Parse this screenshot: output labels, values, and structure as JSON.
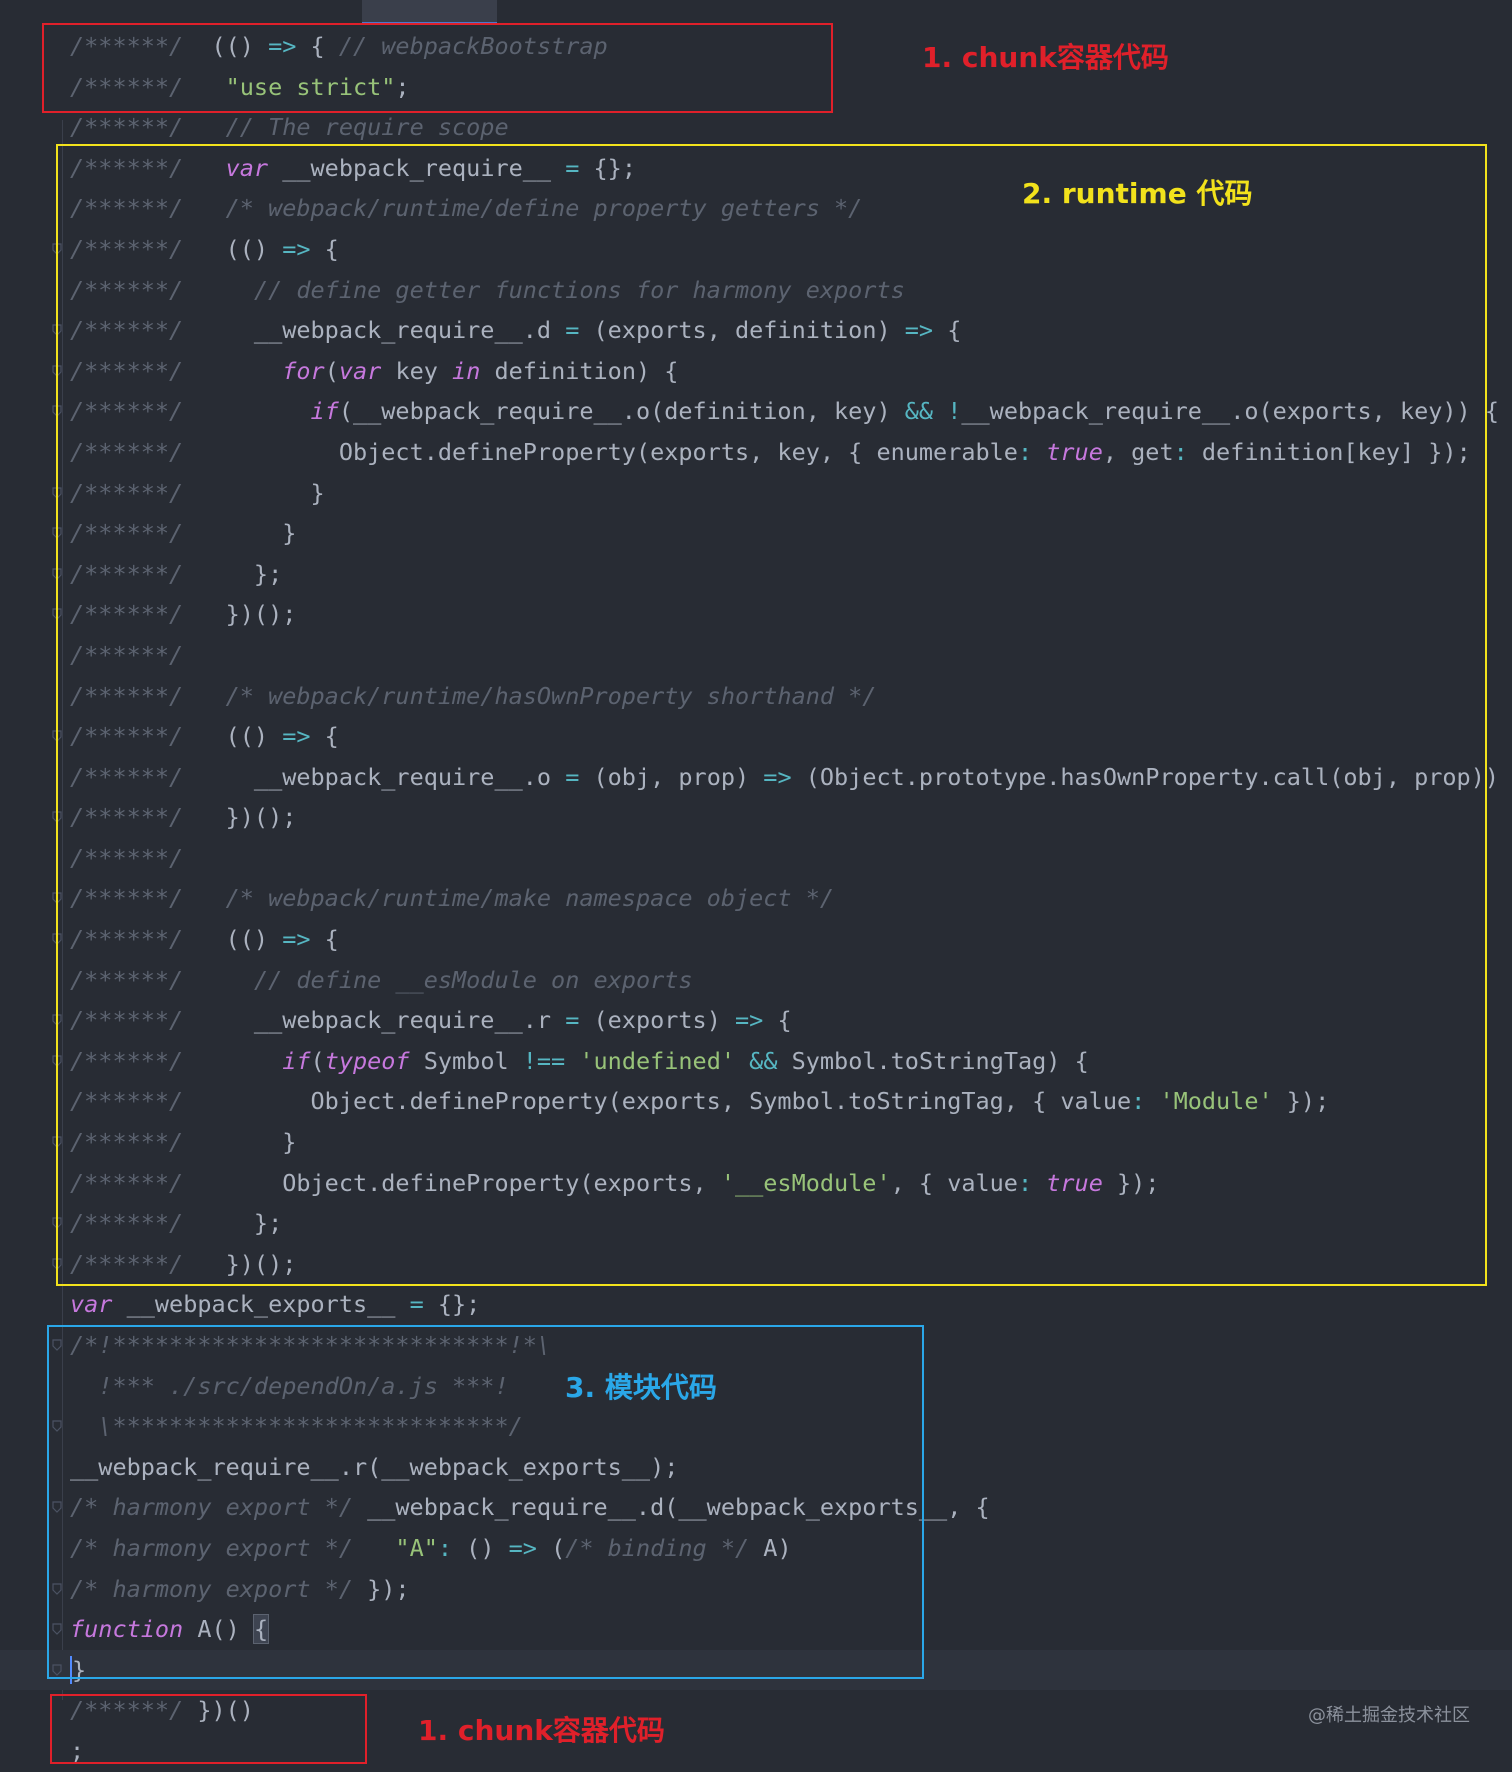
{
  "editor": {
    "line_prefix": "/******/",
    "lines": [
      {
        "fold": false,
        "tokens": [
          [
            "p",
            "/******/ "
          ],
          [
            "t",
            " "
          ],
          [
            "t",
            "(() "
          ],
          [
            "o",
            "=>"
          ],
          [
            "t",
            " { "
          ],
          [
            "c",
            "// webpackBootstrap"
          ]
        ]
      },
      {
        "fold": false,
        "tokens": [
          [
            "p",
            "/******/ "
          ],
          [
            "t",
            "  "
          ],
          [
            "s",
            "\"use strict\""
          ],
          [
            "t",
            ";"
          ]
        ]
      },
      {
        "fold": false,
        "tokens": [
          [
            "p",
            "/******/ "
          ],
          [
            "t",
            "  "
          ],
          [
            "c",
            "// The require scope"
          ]
        ]
      },
      {
        "fold": false,
        "tokens": [
          [
            "p",
            "/******/ "
          ],
          [
            "t",
            "  "
          ],
          [
            "k",
            "var"
          ],
          [
            "t",
            " __webpack_require__ "
          ],
          [
            "o",
            "="
          ],
          [
            "t",
            " {};"
          ]
        ]
      },
      {
        "fold": false,
        "tokens": [
          [
            "p",
            "/******/ "
          ],
          [
            "t",
            "  "
          ],
          [
            "c",
            "/* webpack/runtime/define property getters */"
          ]
        ]
      },
      {
        "fold": true,
        "tokens": [
          [
            "p",
            "/******/ "
          ],
          [
            "t",
            "  (() "
          ],
          [
            "o",
            "=>"
          ],
          [
            "t",
            " {"
          ]
        ]
      },
      {
        "fold": false,
        "tokens": [
          [
            "p",
            "/******/ "
          ],
          [
            "t",
            "    "
          ],
          [
            "c",
            "// define getter functions for harmony exports"
          ]
        ]
      },
      {
        "fold": true,
        "tokens": [
          [
            "p",
            "/******/ "
          ],
          [
            "t",
            "    __webpack_require__.d "
          ],
          [
            "o",
            "="
          ],
          [
            "t",
            " (exports, definition) "
          ],
          [
            "o",
            "=>"
          ],
          [
            "t",
            " {"
          ]
        ]
      },
      {
        "fold": true,
        "tokens": [
          [
            "p",
            "/******/ "
          ],
          [
            "t",
            "      "
          ],
          [
            "k",
            "for"
          ],
          [
            "t",
            "("
          ],
          [
            "k",
            "var"
          ],
          [
            "t",
            " key "
          ],
          [
            "k",
            "in"
          ],
          [
            "t",
            " definition) {"
          ]
        ]
      },
      {
        "fold": true,
        "tokens": [
          [
            "p",
            "/******/ "
          ],
          [
            "t",
            "        "
          ],
          [
            "k",
            "if"
          ],
          [
            "t",
            "(__webpack_require__.o(definition, key) "
          ],
          [
            "o",
            "&&"
          ],
          [
            "t",
            " "
          ],
          [
            "o",
            "!"
          ],
          [
            "t",
            "__webpack_require__.o(exports, key)) {"
          ]
        ]
      },
      {
        "fold": false,
        "tokens": [
          [
            "p",
            "/******/ "
          ],
          [
            "t",
            "          Object.defineProperty(exports, key, { enumerable"
          ],
          [
            "o",
            ":"
          ],
          [
            "t",
            " "
          ],
          [
            "k",
            "true"
          ],
          [
            "t",
            ", get"
          ],
          [
            "o",
            ":"
          ],
          [
            "t",
            " definition[key] });"
          ]
        ]
      },
      {
        "fold": true,
        "tokens": [
          [
            "p",
            "/******/ "
          ],
          [
            "t",
            "        }"
          ]
        ]
      },
      {
        "fold": true,
        "tokens": [
          [
            "p",
            "/******/ "
          ],
          [
            "t",
            "      }"
          ]
        ]
      },
      {
        "fold": true,
        "tokens": [
          [
            "p",
            "/******/ "
          ],
          [
            "t",
            "    };"
          ]
        ]
      },
      {
        "fold": true,
        "tokens": [
          [
            "p",
            "/******/ "
          ],
          [
            "t",
            "  })();"
          ]
        ]
      },
      {
        "fold": false,
        "tokens": [
          [
            "p",
            "/******/"
          ]
        ]
      },
      {
        "fold": false,
        "tokens": [
          [
            "p",
            "/******/ "
          ],
          [
            "t",
            "  "
          ],
          [
            "c",
            "/* webpack/runtime/hasOwnProperty shorthand */"
          ]
        ]
      },
      {
        "fold": true,
        "tokens": [
          [
            "p",
            "/******/ "
          ],
          [
            "t",
            "  (() "
          ],
          [
            "o",
            "=>"
          ],
          [
            "t",
            " {"
          ]
        ]
      },
      {
        "fold": false,
        "tokens": [
          [
            "p",
            "/******/ "
          ],
          [
            "t",
            "    __webpack_require__.o "
          ],
          [
            "o",
            "="
          ],
          [
            "t",
            " (obj, prop) "
          ],
          [
            "o",
            "=>"
          ],
          [
            "t",
            " (Object.prototype.hasOwnProperty.call(obj, prop))"
          ]
        ]
      },
      {
        "fold": true,
        "tokens": [
          [
            "p",
            "/******/ "
          ],
          [
            "t",
            "  })();"
          ]
        ]
      },
      {
        "fold": false,
        "tokens": [
          [
            "p",
            "/******/"
          ]
        ]
      },
      {
        "fold": true,
        "tokens": [
          [
            "p",
            "/******/ "
          ],
          [
            "t",
            "  "
          ],
          [
            "c",
            "/* webpack/runtime/make namespace object */"
          ]
        ]
      },
      {
        "fold": true,
        "tokens": [
          [
            "p",
            "/******/ "
          ],
          [
            "t",
            "  (() "
          ],
          [
            "o",
            "=>"
          ],
          [
            "t",
            " {"
          ]
        ]
      },
      {
        "fold": false,
        "tokens": [
          [
            "p",
            "/******/ "
          ],
          [
            "t",
            "    "
          ],
          [
            "c",
            "// define __esModule on exports"
          ]
        ]
      },
      {
        "fold": true,
        "tokens": [
          [
            "p",
            "/******/ "
          ],
          [
            "t",
            "    __webpack_require__.r "
          ],
          [
            "o",
            "="
          ],
          [
            "t",
            " (exports) "
          ],
          [
            "o",
            "=>"
          ],
          [
            "t",
            " {"
          ]
        ]
      },
      {
        "fold": true,
        "tokens": [
          [
            "p",
            "/******/ "
          ],
          [
            "t",
            "      "
          ],
          [
            "k",
            "if"
          ],
          [
            "t",
            "("
          ],
          [
            "k",
            "typeof"
          ],
          [
            "t",
            " Symbol "
          ],
          [
            "o",
            "!=="
          ],
          [
            "t",
            " "
          ],
          [
            "s",
            "'undefined'"
          ],
          [
            "t",
            " "
          ],
          [
            "o",
            "&&"
          ],
          [
            "t",
            " Symbol.toStringTag) {"
          ]
        ]
      },
      {
        "fold": false,
        "tokens": [
          [
            "p",
            "/******/ "
          ],
          [
            "t",
            "        Object.defineProperty(exports, Symbol.toStringTag, { value"
          ],
          [
            "o",
            ":"
          ],
          [
            "t",
            " "
          ],
          [
            "s",
            "'Module'"
          ],
          [
            "t",
            " });"
          ]
        ]
      },
      {
        "fold": true,
        "tokens": [
          [
            "p",
            "/******/ "
          ],
          [
            "t",
            "      }"
          ]
        ]
      },
      {
        "fold": false,
        "tokens": [
          [
            "p",
            "/******/ "
          ],
          [
            "t",
            "      Object.defineProperty(exports, "
          ],
          [
            "s",
            "'__esModule'"
          ],
          [
            "t",
            ", { value"
          ],
          [
            "o",
            ":"
          ],
          [
            "t",
            " "
          ],
          [
            "k",
            "true"
          ],
          [
            "t",
            " });"
          ]
        ]
      },
      {
        "fold": true,
        "tokens": [
          [
            "p",
            "/******/ "
          ],
          [
            "t",
            "    };"
          ]
        ]
      },
      {
        "fold": true,
        "tokens": [
          [
            "p",
            "/******/ "
          ],
          [
            "t",
            "  })();"
          ]
        ]
      },
      {
        "fold": false,
        "tokens": [
          [
            "k",
            "var"
          ],
          [
            "t",
            " __webpack_exports__ "
          ],
          [
            "o",
            "="
          ],
          [
            "t",
            " {};"
          ]
        ]
      },
      {
        "fold": true,
        "tokens": [
          [
            "c",
            "/*!****************************!*\\"
          ]
        ]
      },
      {
        "fold": false,
        "tokens": [
          [
            "c",
            "  !*** ./src/dependOn/a.js ***!"
          ]
        ]
      },
      {
        "fold": true,
        "tokens": [
          [
            "c",
            "  \\****************************/"
          ]
        ]
      },
      {
        "fold": false,
        "tokens": [
          [
            "t",
            "__webpack_require__.r(__webpack_exports__);"
          ]
        ]
      },
      {
        "fold": true,
        "tokens": [
          [
            "c",
            "/* harmony export */"
          ],
          [
            "t",
            " __webpack_require__.d(__webpack_exports__, {"
          ]
        ]
      },
      {
        "fold": false,
        "tokens": [
          [
            "c",
            "/* harmony export */"
          ],
          [
            "t",
            "   "
          ],
          [
            "s",
            "\"A\""
          ],
          [
            "o",
            ":"
          ],
          [
            "t",
            " () "
          ],
          [
            "o",
            "=>"
          ],
          [
            "t",
            " ("
          ],
          [
            "c",
            "/* binding */"
          ],
          [
            "t",
            " A)"
          ]
        ]
      },
      {
        "fold": true,
        "tokens": [
          [
            "c",
            "/* harmony export */"
          ],
          [
            "t",
            " });"
          ]
        ]
      },
      {
        "fold": true,
        "tokens": [
          [
            "k",
            "function"
          ],
          [
            "t",
            " A() "
          ],
          [
            "b",
            "{"
          ]
        ]
      },
      {
        "fold": true,
        "current": true,
        "tokens": [
          [
            "u",
            "}"
          ]
        ]
      },
      {
        "fold": false,
        "tokens": [
          [
            "p",
            "/******/ "
          ],
          [
            "t",
            "})()"
          ]
        ]
      },
      {
        "fold": false,
        "tokens": [
          [
            "t",
            ";"
          ]
        ]
      }
    ]
  },
  "annotations": {
    "chunk_container_top": "1. chunk容器代码",
    "runtime": "2. runtime 代码",
    "module": "3. 模块代码",
    "chunk_container_bottom": "1. chunk容器代码"
  },
  "watermark": "@稀土掘金技术社区",
  "colors": {
    "background": "#282c34",
    "comment": "#5c6370",
    "keyword": "#c678dd",
    "string": "#98c379",
    "operator": "#56b6c2",
    "text": "#abb2bf",
    "box_red": "#e0202a",
    "box_yellow": "#f2e21c",
    "box_blue": "#2aa7e8"
  }
}
